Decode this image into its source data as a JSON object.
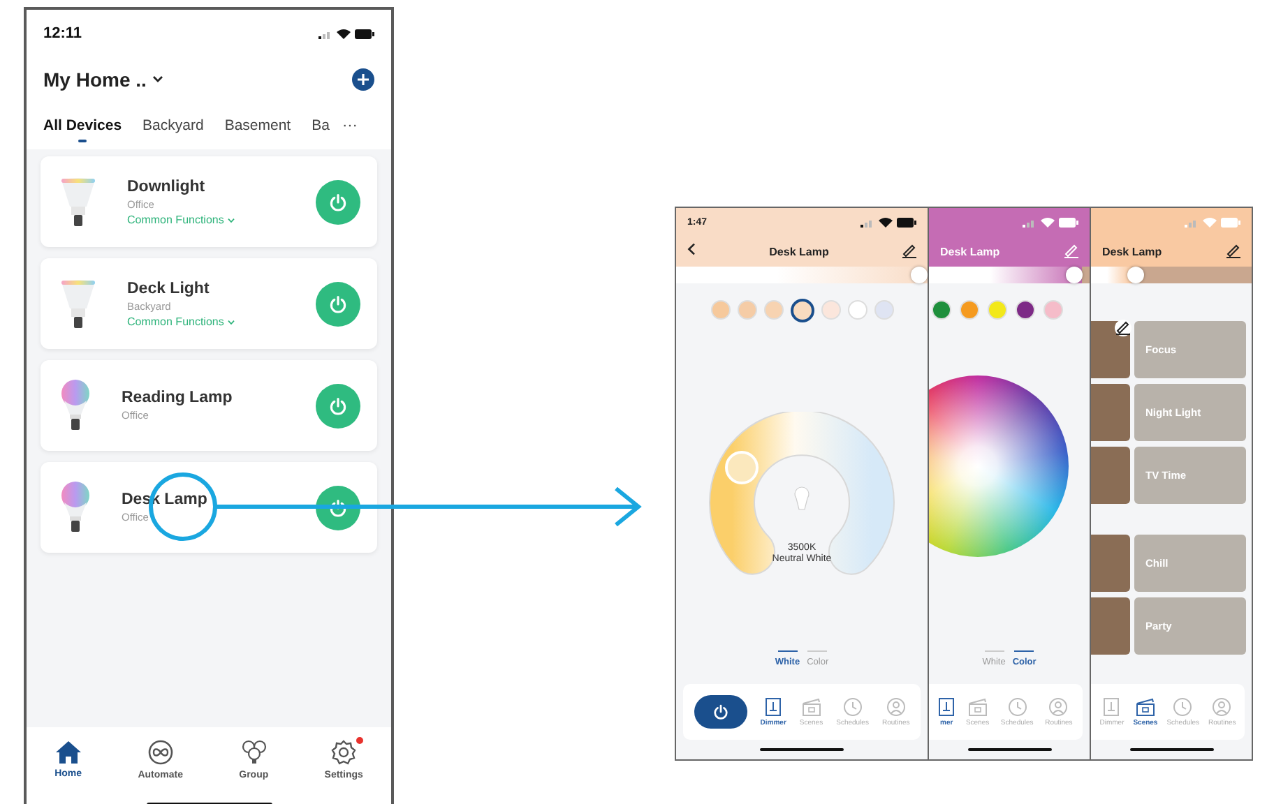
{
  "home_screen": {
    "time": "12:11",
    "home_name": "My Home ..",
    "tabs": [
      {
        "label": "All Devices",
        "selected": true
      },
      {
        "label": "Backyard",
        "selected": false
      },
      {
        "label": "Basement",
        "selected": false
      },
      {
        "label": "Ba",
        "selected": false
      }
    ],
    "more": "···",
    "devices": [
      {
        "name": "Downlight",
        "room": "Office",
        "functions": "Common Functions",
        "kind": "flood",
        "on": true
      },
      {
        "name": "Deck Light",
        "room": "Backyard",
        "functions": "Common Functions",
        "kind": "flood",
        "on": true
      },
      {
        "name": "Reading Lamp",
        "room": "Office",
        "kind": "bulb",
        "on": true
      },
      {
        "name": "Desk Lamp",
        "room": "Office",
        "kind": "bulb",
        "on": true
      }
    ],
    "nav": [
      {
        "label": "Home",
        "kind": "home",
        "selected": true,
        "badge": false
      },
      {
        "label": "Automate",
        "kind": "automate",
        "selected": false,
        "badge": false
      },
      {
        "label": "Group",
        "kind": "group",
        "selected": false,
        "badge": false
      },
      {
        "label": "Settings",
        "kind": "settings",
        "selected": false,
        "badge": true
      }
    ]
  },
  "detail_screens": [
    {
      "kind": "white",
      "color": "#f9dcc6",
      "time": "1:47",
      "title": "Desk Lamp",
      "brightness": {
        "level": 1
      },
      "swatches": [
        {
          "color": "#f6c99c",
          "selected": false
        },
        {
          "color": "#f5cca6",
          "selected": false
        },
        {
          "color": "#f7d3b1",
          "selected": false
        },
        {
          "color": "#f9dcc0",
          "selected": true
        },
        {
          "color": "#fbe6dc",
          "selected": false
        },
        {
          "color": "#ffffff",
          "selected": false
        },
        {
          "color": "#dfe4f3",
          "selected": false
        }
      ],
      "temperature": "3500K",
      "temperature_name": "Neutral White",
      "modes": [
        {
          "label": "White",
          "selected": true
        },
        {
          "label": "Color",
          "selected": false
        }
      ],
      "power_on": true,
      "nav": [
        {
          "label": "Dimmer",
          "kind": "dimmer",
          "selected": true
        },
        {
          "label": "Scenes",
          "kind": "scenes",
          "selected": false
        },
        {
          "label": "Schedules",
          "kind": "schedules",
          "selected": false
        },
        {
          "label": "Routines",
          "kind": "routines",
          "selected": false
        }
      ]
    },
    {
      "kind": "color",
      "color": "#c56cb4",
      "title": "Desk Lamp",
      "brightness": {
        "level": 0.95
      },
      "swatches": [
        {
          "color": "#1e8f3c",
          "selected": false
        },
        {
          "color": "#f59a1f",
          "selected": false
        },
        {
          "color": "#f2e81a",
          "selected": false
        },
        {
          "color": "#7d2a86",
          "selected": false
        },
        {
          "color": "#f5bcc9",
          "selected": false
        }
      ],
      "modes": [
        {
          "label": "White",
          "selected": false
        },
        {
          "label": "Color",
          "selected": true
        }
      ],
      "nav": [
        {
          "label": "mer",
          "kind": "dimmer",
          "selected": true
        },
        {
          "label": "Scenes",
          "kind": "scenes",
          "selected": false
        },
        {
          "label": "Schedules",
          "kind": "schedules",
          "selected": false
        },
        {
          "label": "Routines",
          "kind": "routines",
          "selected": false
        }
      ]
    },
    {
      "kind": "scenes",
      "color": "#f9c9a2",
      "title": "Desk Lamp",
      "brightness": {
        "level": 0.25
      },
      "scene_groups": [
        {
          "scenes": [
            {
              "label": "Focus"
            },
            {
              "label": "Night Light"
            },
            {
              "label": "TV Time"
            }
          ]
        },
        {
          "scenes": [
            {
              "label": "Chill"
            },
            {
              "label": "Party"
            }
          ]
        }
      ],
      "nav": [
        {
          "label": "Dimmer",
          "kind": "dimmer",
          "selected": false
        },
        {
          "label": "Scenes",
          "kind": "scenes",
          "selected": true
        },
        {
          "label": "Schedules",
          "kind": "schedules",
          "selected": false
        },
        {
          "label": "Routines",
          "kind": "routines",
          "selected": false
        }
      ]
    }
  ]
}
